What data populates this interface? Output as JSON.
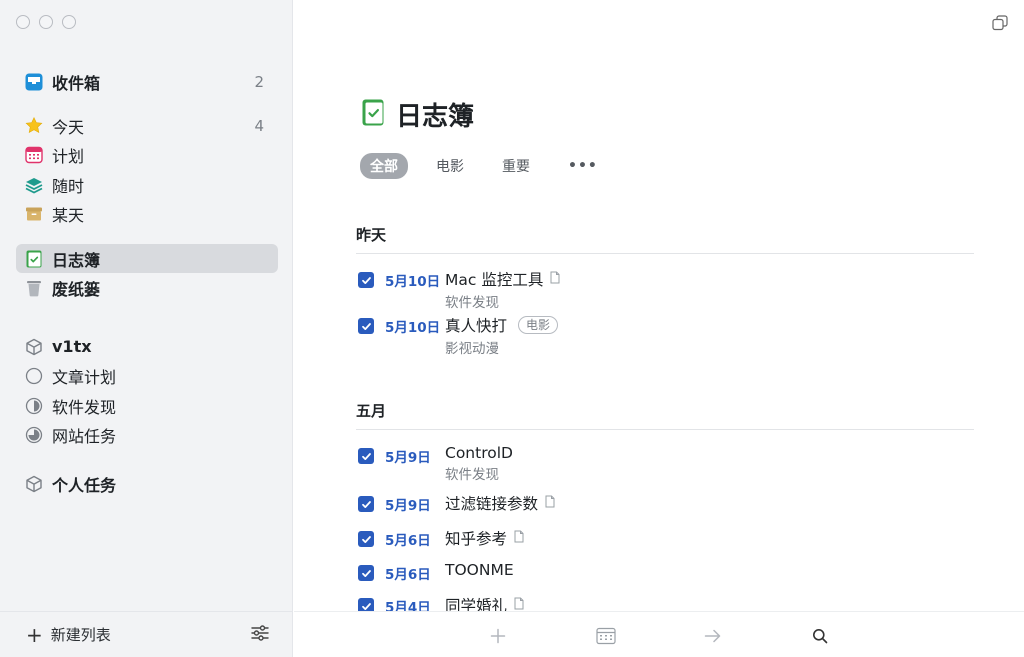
{
  "window": {
    "title": "日志簿"
  },
  "sidebar": {
    "items": [
      {
        "label": "收件箱",
        "count": "2",
        "icon": "inbox-icon"
      },
      {
        "label": "今天",
        "count": "4",
        "icon": "star-icon"
      },
      {
        "label": "计划",
        "icon": "calendar-icon"
      },
      {
        "label": "随时",
        "icon": "layers-icon"
      },
      {
        "label": "某天",
        "icon": "archive-box-icon"
      },
      {
        "label": "日志簿",
        "icon": "logbook-icon",
        "selected": true
      },
      {
        "label": "废纸篓",
        "icon": "trash-icon"
      }
    ],
    "areas": [
      {
        "label": "v1tx",
        "icon": "area-cube-icon"
      },
      {
        "label": "文章计划",
        "icon": "project-circle-empty-icon"
      },
      {
        "label": "软件发现",
        "icon": "project-circle-half-icon"
      },
      {
        "label": "网站任务",
        "icon": "project-circle-mostly-icon"
      },
      {
        "label": "个人任务",
        "icon": "area-cube-icon"
      }
    ],
    "footer": {
      "new_list_label": "新建列表"
    }
  },
  "main": {
    "title": "日志簿",
    "tabs": [
      "全部",
      "电影",
      "重要",
      "•••"
    ],
    "sections": [
      {
        "header": "昨天",
        "tasks": [
          {
            "date": "5月10日",
            "title": "Mac 监控工具",
            "subtitle": "软件发现",
            "has_note": true
          },
          {
            "date": "5月10日",
            "title": "真人快打",
            "subtitle": "影视动漫",
            "tag": "电影"
          }
        ]
      },
      {
        "header": "五月",
        "tasks": [
          {
            "date": "5月9日",
            "title": "ControlD",
            "subtitle": "软件发现"
          },
          {
            "date": "5月9日",
            "title": "过滤链接参数",
            "has_note": true
          },
          {
            "date": "5月6日",
            "title": "知乎参考",
            "has_note": true
          },
          {
            "date": "5月6日",
            "title": "TOONME"
          },
          {
            "date": "5月4日",
            "title": "同学婚礼",
            "has_note": true
          }
        ]
      }
    ]
  },
  "colors": {
    "accent": "#2a5bbd",
    "logbook_green": "#3aa34a",
    "sidebar_bg": "#f2f3f5",
    "selected_bg": "#d8dade"
  }
}
